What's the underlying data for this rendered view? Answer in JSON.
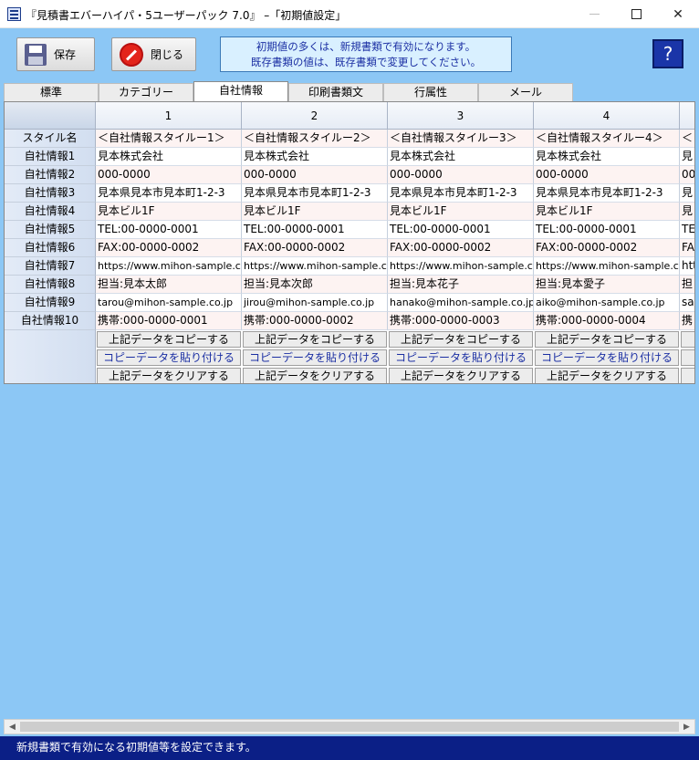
{
  "window": {
    "title": "『見積書エバーハイパ・5ユーザーパック 7.0』 –「初期値設定」",
    "minimize_glyph": "–",
    "close_glyph": "✕"
  },
  "toolbar": {
    "save_label": "保存",
    "close_label": "閉じる",
    "info_line1": "初期値の多くは、新規書類で有効になります。",
    "info_line2": "既存書類の値は、既存書類で変更してください。",
    "help_glyph": "?"
  },
  "tabs": [
    {
      "label": "標準"
    },
    {
      "label": "カテゴリー"
    },
    {
      "label": "自社情報"
    },
    {
      "label": "印刷書類文"
    },
    {
      "label": "行属性"
    },
    {
      "label": "メール"
    }
  ],
  "grid": {
    "columns": [
      "1",
      "2",
      "3",
      "4"
    ],
    "row_headers": [
      "スタイル名",
      "自社情報1",
      "自社情報2",
      "自社情報3",
      "自社情報4",
      "自社情報5",
      "自社情報6",
      "自社情報7",
      "自社情報8",
      "自社情報9",
      "自社情報10"
    ],
    "cells": [
      [
        "＜自社情報スタイルー1＞",
        "見本株式会社",
        "000-0000",
        "見本県見本市見本町1-2-3",
        "見本ビル1F",
        "TEL:00-0000-0001",
        "FAX:00-0000-0002",
        "https://www.mihon-sample.co.jp",
        "担当:見本太郎",
        "tarou@mihon-sample.co.jp",
        "携帯:000-0000-0001"
      ],
      [
        "＜自社情報スタイルー2＞",
        "見本株式会社",
        "000-0000",
        "見本県見本市見本町1-2-3",
        "見本ビル1F",
        "TEL:00-0000-0001",
        "FAX:00-0000-0002",
        "https://www.mihon-sample.co.jp",
        "担当:見本次郎",
        "jirou@mihon-sample.co.jp",
        "携帯:000-0000-0002"
      ],
      [
        "＜自社情報スタイルー3＞",
        "見本株式会社",
        "000-0000",
        "見本県見本市見本町1-2-3",
        "見本ビル1F",
        "TEL:00-0000-0001",
        "FAX:00-0000-0002",
        "https://www.mihon-sample.co.jp",
        "担当:見本花子",
        "hanako@mihon-sample.co.jp",
        "携帯:000-0000-0003"
      ],
      [
        "＜自社情報スタイルー4＞",
        "見本株式会社",
        "000-0000",
        "見本県見本市見本町1-2-3",
        "見本ビル1F",
        "TEL:00-0000-0001",
        "FAX:00-0000-0002",
        "https://www.mihon-sample.co.jp",
        "担当:見本愛子",
        "aiko@mihon-sample.co.jp",
        "携帯:000-0000-0004"
      ]
    ],
    "partial_column": [
      "＜",
      "見",
      "00",
      "見",
      "見",
      "TE",
      "FA",
      "htt",
      "担",
      "sab",
      "携"
    ],
    "actions": {
      "copy": "上記データをコピーする",
      "paste": "コピーデータを貼り付ける",
      "clear": "上記データをクリアする"
    }
  },
  "status": {
    "text": "新規書類で有効になる初期値等を設定できます。"
  }
}
